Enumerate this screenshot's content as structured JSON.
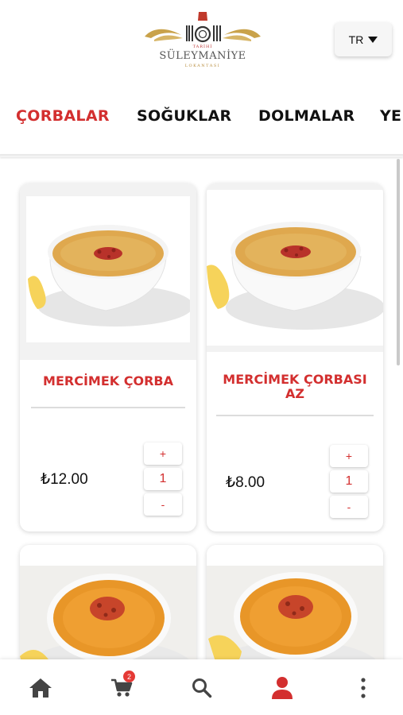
{
  "header": {
    "logo_top": "TARİHİ",
    "logo_name": "SÜLEYMANİYE",
    "logo_sub": "LOKANTASI",
    "language": "TR"
  },
  "tabs": [
    {
      "label": "ÇORBALAR",
      "active": true
    },
    {
      "label": "SOĞUKLAR",
      "active": false
    },
    {
      "label": "DOLMALAR",
      "active": false
    },
    {
      "label": "YEMEKLER",
      "active": false
    }
  ],
  "products": [
    {
      "name": "MERCİMEK ÇORBA",
      "price": "₺12.00",
      "qty": "1",
      "plus": "+",
      "minus": "-"
    },
    {
      "name": "MERCİMEK ÇORBASI AZ",
      "price": "₺8.00",
      "qty": "1",
      "plus": "+",
      "minus": "-"
    }
  ],
  "bottom_nav": {
    "items": [
      "home-icon",
      "cart-icon",
      "search-icon",
      "user-icon",
      "more-vertical-icon"
    ],
    "cart_count": "2",
    "active": "user-icon",
    "active_color": "#d32f2f"
  },
  "colors": {
    "accent": "#d32f2f",
    "brand_gold": "#b88d3e"
  }
}
